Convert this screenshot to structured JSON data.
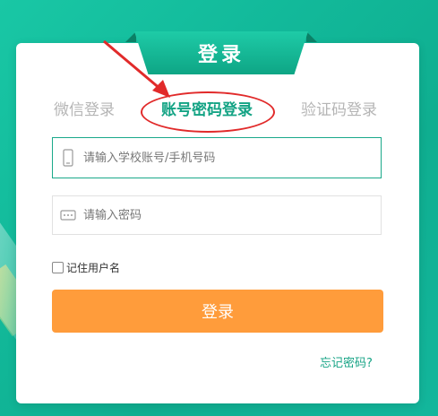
{
  "ribbon": {
    "title": "登录"
  },
  "tabs": [
    {
      "label": "微信登录"
    },
    {
      "label": "账号密码登录"
    },
    {
      "label": "验证码登录"
    }
  ],
  "account_field": {
    "placeholder": "请输入学校账号/手机号码"
  },
  "password_field": {
    "placeholder": "请输入密码"
  },
  "remember": {
    "label": "记住用户名"
  },
  "login_button": {
    "label": "登录"
  },
  "forgot_link": {
    "label": "忘记密码?"
  },
  "colors": {
    "accent": "#13a384",
    "button": "#ff9c3b",
    "annotation": "#e12a2a"
  }
}
